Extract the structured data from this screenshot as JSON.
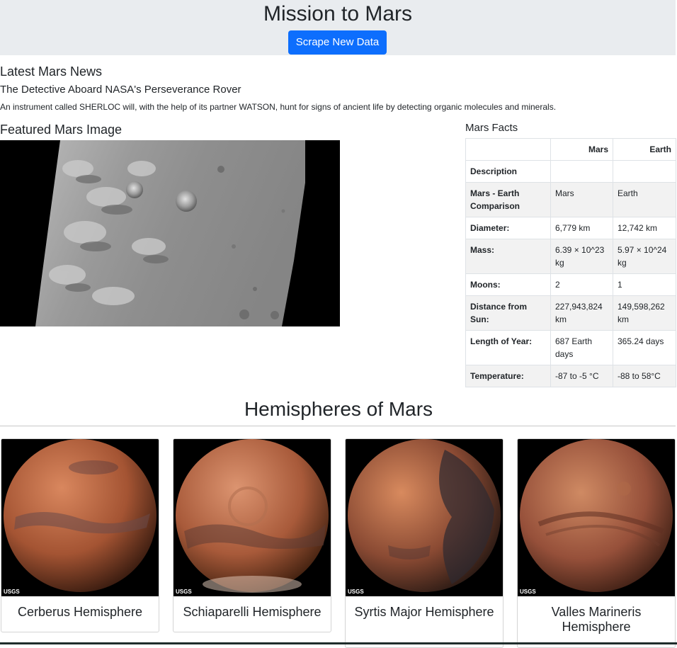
{
  "header": {
    "title": "Mission to Mars",
    "scrape_button": "Scrape New Data"
  },
  "news": {
    "heading": "Latest Mars News",
    "title": "The Detective Aboard NASA's Perseverance Rover",
    "teaser": "An instrument called SHERLOC will, with the help of its partner WATSON, hunt for signs of ancient life by detecting organic molecules and minerals."
  },
  "featured": {
    "heading": "Featured Mars Image"
  },
  "facts": {
    "heading": "Mars Facts",
    "columns": [
      "",
      "Mars",
      "Earth"
    ],
    "rows": [
      {
        "label": "Description",
        "mars": "",
        "earth": ""
      },
      {
        "label": "Mars - Earth Comparison",
        "mars": "Mars",
        "earth": "Earth"
      },
      {
        "label": "Diameter:",
        "mars": "6,779 km",
        "earth": "12,742 km"
      },
      {
        "label": "Mass:",
        "mars": "6.39 × 10^23 kg",
        "earth": "5.97 × 10^24 kg"
      },
      {
        "label": "Moons:",
        "mars": "2",
        "earth": "1"
      },
      {
        "label": "Distance from Sun:",
        "mars": "227,943,824 km",
        "earth": "149,598,262 km"
      },
      {
        "label": "Length of Year:",
        "mars": "687 Earth days",
        "earth": "365.24 days"
      },
      {
        "label": "Temperature:",
        "mars": "-87 to -5 °C",
        "earth": "-88 to 58°C"
      }
    ]
  },
  "hemispheres": {
    "heading": "Hemispheres of Mars",
    "items": [
      {
        "title": "Cerberus Hemisphere",
        "logo": "USGS",
        "colors": [
          "#d9875e",
          "#a45433",
          "#3a1c10"
        ]
      },
      {
        "title": "Schiaparelli Hemisphere",
        "logo": "USGS",
        "colors": [
          "#dc9470",
          "#a85a3a",
          "#40200f"
        ]
      },
      {
        "title": "Syrtis Major Hemisphere",
        "logo": "USGS",
        "colors": [
          "#d88a5e",
          "#8a4a33",
          "#2a1a14"
        ]
      },
      {
        "title": "Valles Marineris Hemisphere",
        "logo": "USGS",
        "colors": [
          "#cf8a63",
          "#96503a",
          "#381c12"
        ]
      }
    ]
  },
  "colors": {
    "jumbotron": "#e9ecef",
    "primary": "#0d6efd"
  }
}
